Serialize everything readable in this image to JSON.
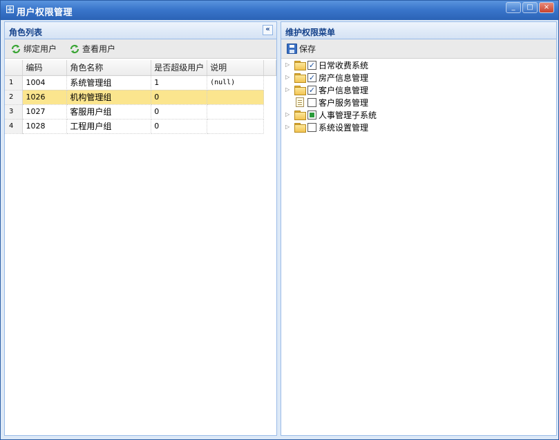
{
  "window": {
    "title": "用户权限管理",
    "buttons": [
      "_",
      "□",
      "×"
    ]
  },
  "left_panel": {
    "title": "角色列表",
    "collapse_glyph": "«",
    "toolbar": [
      {
        "label": "绑定用户",
        "icon": "refresh-icon"
      },
      {
        "label": "查看用户",
        "icon": "refresh-icon"
      }
    ],
    "columns": [
      "编码",
      "角色名称",
      "是否超级用户",
      "说明"
    ],
    "rows": [
      {
        "n": "1",
        "code": "1004",
        "name": "系统管理组",
        "super": "1",
        "desc": "(null)"
      },
      {
        "n": "2",
        "code": "1026",
        "name": "机构管理组",
        "super": "0",
        "desc": ""
      },
      {
        "n": "3",
        "code": "1027",
        "name": "客服用户组",
        "super": "0",
        "desc": ""
      },
      {
        "n": "4",
        "code": "1028",
        "name": "工程用户组",
        "super": "0",
        "desc": ""
      }
    ],
    "selected_row": 2
  },
  "right_panel": {
    "title": "维护权限菜单",
    "save_label": "保存",
    "tree": [
      {
        "label": "日常收费系统",
        "type": "folder",
        "check": "checked"
      },
      {
        "label": "房产信息管理",
        "type": "folder",
        "check": "checked"
      },
      {
        "label": "客户信息管理",
        "type": "folder",
        "check": "checked"
      },
      {
        "label": "客户服务管理",
        "type": "file",
        "check": "unchecked"
      },
      {
        "label": "人事管理子系统",
        "type": "folder",
        "check": "partial"
      },
      {
        "label": "系统设置管理",
        "type": "folder",
        "check": "unchecked"
      }
    ]
  },
  "colors": {
    "titlebar": "#3a76cb",
    "panel_header_text": "#15428b",
    "selected_row": "#fbe58e"
  }
}
